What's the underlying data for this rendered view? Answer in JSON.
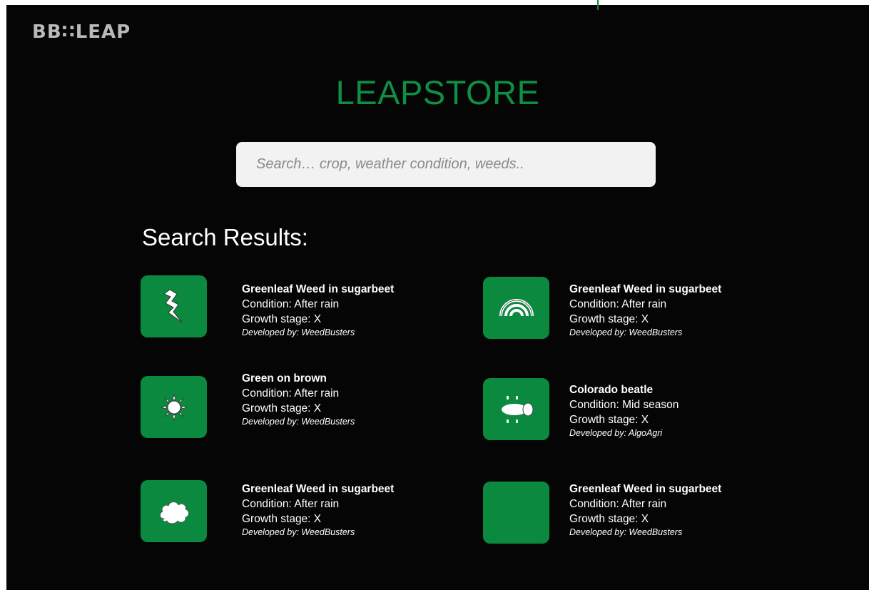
{
  "app": {
    "logo_text": "BB∷LEAP",
    "title": "LEAPSTORE"
  },
  "search": {
    "placeholder": "Search… crop, weather condition, weeds.."
  },
  "results_heading": "Search Results:",
  "results": [
    {
      "icon": "lightning-icon",
      "name": "Greenleaf Weed in sugarbeet",
      "condition": "Condition: After rain",
      "growth": "Growth stage: X",
      "developer": "Developed by: WeedBusters"
    },
    {
      "icon": "rainbow-icon",
      "name": "Greenleaf Weed in sugarbeet",
      "condition": "Condition: After rain",
      "growth": "Growth stage: X",
      "developer": "Developed by: WeedBusters"
    },
    {
      "icon": "sun-icon",
      "name": "Green on brown",
      "condition": "Condition: After rain",
      "growth": "Growth stage: X",
      "developer": "Developed by: WeedBusters"
    },
    {
      "icon": "beetle-icon",
      "name": "Colorado beatle",
      "condition": "Condition: Mid season",
      "growth": "Growth stage: X",
      "developer": "Developed by: AlgoAgri"
    },
    {
      "icon": "cloud-icon",
      "name": "Greenleaf Weed in sugarbeet",
      "condition": "Condition: After rain",
      "growth": "Growth stage: X",
      "developer": "Developed by: WeedBusters"
    },
    {
      "icon": "blank-icon",
      "name": "Greenleaf Weed in sugarbeet",
      "condition": "Condition: After rain",
      "growth": "Growth stage: X",
      "developer": "Developed by: WeedBusters"
    }
  ],
  "colors": {
    "accent": "#0b8a3f",
    "title": "#0f8f45",
    "background": "#050505"
  }
}
